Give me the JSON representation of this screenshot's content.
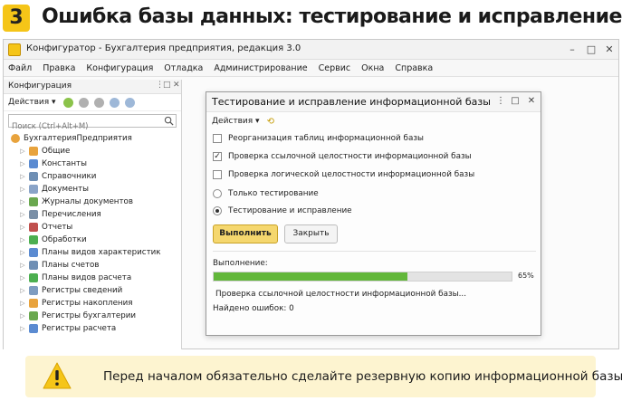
{
  "header": {
    "step_number": "3",
    "title": "Ошибка базы данных: тестирование и исправление"
  },
  "app": {
    "title": "Конфигуратор - Бухгалтерия предприятия, редакция 3.0",
    "menu": [
      "Файл",
      "Правка",
      "Конфигурация",
      "Отладка",
      "Администрирование",
      "Сервис",
      "Окна",
      "Справка"
    ]
  },
  "config_panel": {
    "title": "Конфигурация",
    "actions_label": "Действия",
    "search_placeholder": "Поиск (Ctrl+Alt+M)",
    "root": "БухгалтерияПредприятия",
    "items": [
      {
        "label": "Общие",
        "icon": "folder-icon",
        "color": "#e8a33d"
      },
      {
        "label": "Константы",
        "icon": "constants-icon",
        "color": "#5b8bd1"
      },
      {
        "label": "Справочники",
        "icon": "catalog-icon",
        "color": "#6f8fb4"
      },
      {
        "label": "Документы",
        "icon": "document-icon",
        "color": "#8aa4c8"
      },
      {
        "label": "Журналы документов",
        "icon": "journal-icon",
        "color": "#6aa84f"
      },
      {
        "label": "Перечисления",
        "icon": "enum-icon",
        "color": "#7a8fa6"
      },
      {
        "label": "Отчеты",
        "icon": "report-icon",
        "color": "#c0504d"
      },
      {
        "label": "Обработки",
        "icon": "processing-icon",
        "color": "#4caf50"
      },
      {
        "label": "Планы видов характеристик",
        "icon": "plan-char-icon",
        "color": "#5b8bd1"
      },
      {
        "label": "Планы счетов",
        "icon": "chart-accounts-icon",
        "color": "#6f8fb4"
      },
      {
        "label": "Планы видов расчета",
        "icon": "calc-plan-icon",
        "color": "#4caf50"
      },
      {
        "label": "Регистры сведений",
        "icon": "info-register-icon",
        "color": "#7e9cc0"
      },
      {
        "label": "Регистры накопления",
        "icon": "accum-register-icon",
        "color": "#e8a33d"
      },
      {
        "label": "Регистры бухгалтерии",
        "icon": "acc-register-icon",
        "color": "#6aa84f"
      },
      {
        "label": "Регистры расчета",
        "icon": "calc-register-icon",
        "color": "#5b8bd1"
      }
    ]
  },
  "dialog": {
    "title": "Тестирование и исправление информационной базы",
    "actions_label": "Действия",
    "checkboxes": [
      {
        "label": "Реорганизация таблиц информационной базы",
        "checked": false
      },
      {
        "label": "Проверка ссылочной целостности информационной базы",
        "checked": true
      },
      {
        "label": "Проверка логической целостности информационной базы",
        "checked": false
      }
    ],
    "radios": [
      {
        "label": "Только тестирование",
        "selected": false
      },
      {
        "label": "Тестирование и исправление",
        "selected": true
      }
    ],
    "run_label": "Выполнить",
    "close_label": "Закрыть",
    "progress_label": "Выполнение:",
    "progress_value": 65,
    "progress_text": "65%",
    "status_text": "Проверка ссылочной целостности информационной базы...",
    "errors_text": "Найдено ошибок: 0"
  },
  "warning": {
    "text": "Перед началом обязательно сделайте резервную копию информационной базы!",
    "icon": "warning-icon",
    "color": "#f5c518"
  }
}
